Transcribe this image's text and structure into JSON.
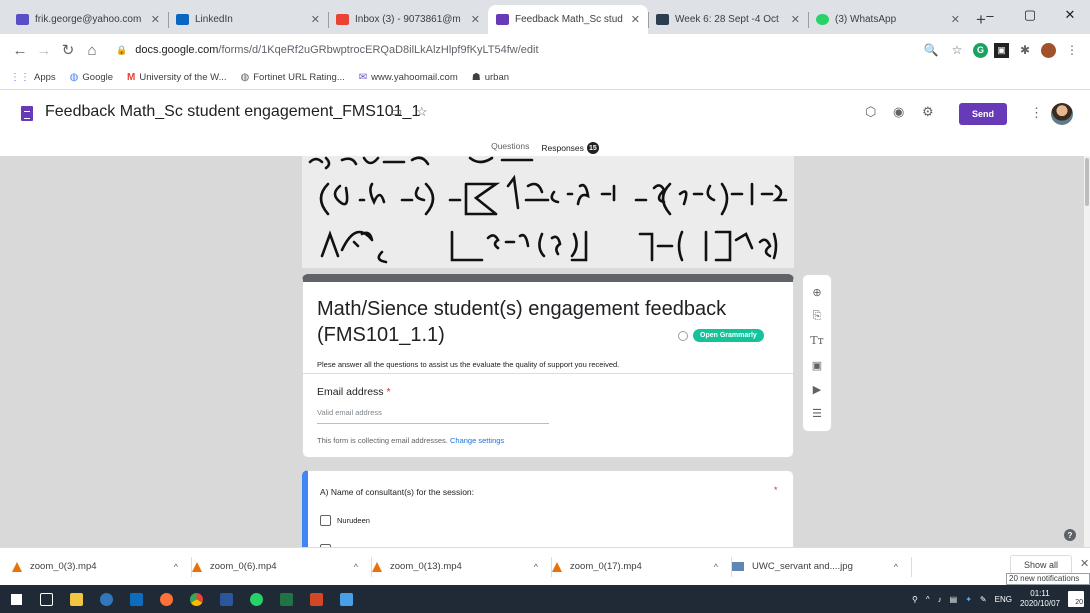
{
  "browser": {
    "tabs": [
      {
        "label": "frik.george@yahoo.com",
        "favicon_color": "#5b4fc9",
        "active": false
      },
      {
        "label": "LinkedIn",
        "favicon_color": "#0a66c2",
        "active": false
      },
      {
        "label": "Inbox (3) - 9073861@m",
        "favicon_color": "#ea4335",
        "active": false
      },
      {
        "label": "Feedback Math_Sc stud",
        "favicon_color": "#673ab7",
        "active": true
      },
      {
        "label": "Week 6: 28 Sept -4 Oct",
        "favicon_color": "#2d3e50",
        "active": false
      },
      {
        "label": "(3) WhatsApp",
        "favicon_color": "#25d366",
        "active": false
      }
    ],
    "new_tab": "+",
    "window_controls": {
      "minimize": "–",
      "maximize": "▢",
      "close": "✕"
    },
    "url_domain": "docs.google.com",
    "url_path": "/forms/d/1KqeRf2uGRbwptrocERQaD8ilLkAlzHlpf9fKyLT54fw/edit",
    "bookmarks": [
      {
        "label": "Apps",
        "icon": "apps-grid-icon"
      },
      {
        "label": "Google",
        "icon": "google-icon"
      },
      {
        "label": "University of the W...",
        "icon": "gmail-icon"
      },
      {
        "label": "Fortinet URL Rating...",
        "icon": "fortinet-icon"
      },
      {
        "label": "www.yahoomail.com",
        "icon": "yahoo-mail-icon"
      },
      {
        "label": "urban",
        "icon": "urban-icon"
      }
    ]
  },
  "forms_header": {
    "title": "Feedback Math_Sc student engagement_FMS101_1",
    "send_label": "Send",
    "tab_questions": "Questions",
    "tab_responses": "Responses",
    "responses_count": "15"
  },
  "form": {
    "title_line1": "Math/Sience student(s) engagement feedback",
    "title_line2": "(FMS101_1.1)",
    "grammarly_label": "Open Grammarly",
    "description": "Plese answer all the questions to assist us the evaluate the quality of support you received.",
    "email_label": "Email address",
    "required_mark": "*",
    "email_placeholder": "Valid email address",
    "email_note": "This form is collecting email addresses.",
    "change_settings": "Change settings",
    "question_a": "A) Name of consultant(s) for the session:",
    "option_1": "Nurudeen"
  },
  "downloads": [
    {
      "name": "zoom_0(3).mp4",
      "icon": "vlc-icon"
    },
    {
      "name": "zoom_0(6).mp4",
      "icon": "vlc-icon"
    },
    {
      "name": "zoom_0(13).mp4",
      "icon": "vlc-icon"
    },
    {
      "name": "zoom_0(17).mp4",
      "icon": "vlc-icon"
    },
    {
      "name": "UWC_servant and....jpg",
      "icon": "image-file-icon"
    }
  ],
  "show_all": "Show all",
  "notification_text": "20 new notifications",
  "taskbar": {
    "apps": [
      {
        "name": "windows-start-icon",
        "color": "#ffffff"
      },
      {
        "name": "task-view-icon",
        "color": "#ffffff"
      },
      {
        "name": "file-explorer-icon",
        "color": "#f4c542"
      },
      {
        "name": "edge-icon",
        "color": "#3277bc"
      },
      {
        "name": "outlook-icon",
        "color": "#0f6cbd"
      },
      {
        "name": "firefox-icon",
        "color": "#ff7139"
      },
      {
        "name": "chrome-icon",
        "color": "#f4b400"
      },
      {
        "name": "word-icon",
        "color": "#2b579a"
      },
      {
        "name": "whatsapp-icon",
        "color": "#25d366"
      },
      {
        "name": "excel-icon",
        "color": "#217346"
      },
      {
        "name": "powerpoint-icon",
        "color": "#d24726"
      },
      {
        "name": "photos-icon",
        "color": "#4aa0e6"
      }
    ],
    "language": "ENG",
    "time": "01:11",
    "date": "2020/10/07",
    "notification_count": "20"
  }
}
